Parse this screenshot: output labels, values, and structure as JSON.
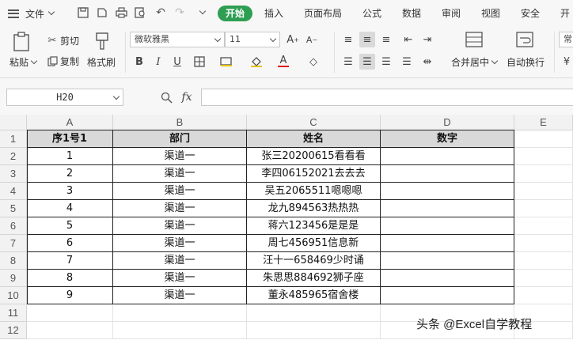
{
  "menubar": {
    "file_label": "文件",
    "tabs": [
      "开始",
      "插入",
      "页面布局",
      "公式",
      "数据",
      "审阅",
      "视图",
      "安全",
      "开"
    ]
  },
  "ribbon": {
    "paste_label": "粘贴",
    "cut_label": "剪切",
    "copy_label": "复制",
    "format_painter_label": "格式刷",
    "font_name": "微软雅黑",
    "font_size": "11",
    "merge_center_label": "合并居中",
    "wrap_text_label": "自动换行",
    "number_format_label": "常"
  },
  "formula_bar": {
    "name_box": "H20",
    "fx_label": "fx",
    "formula_value": ""
  },
  "sheet": {
    "columns": [
      "A",
      "B",
      "C",
      "D",
      "E"
    ],
    "row_numbers": [
      "1",
      "2",
      "3",
      "4",
      "5",
      "6",
      "7",
      "8",
      "9",
      "10",
      "11",
      "12"
    ],
    "header": [
      "序1号1",
      "部门",
      "姓名",
      "数字"
    ],
    "rows": [
      [
        "1",
        "渠道一",
        "张三20200615看看看",
        ""
      ],
      [
        "2",
        "渠道一",
        "李四06152021去去去",
        ""
      ],
      [
        "3",
        "渠道一",
        "吴五2065511嗯嗯嗯",
        ""
      ],
      [
        "4",
        "渠道一",
        "龙九894563热热热",
        ""
      ],
      [
        "5",
        "渠道一",
        "蒋六123456是是是",
        ""
      ],
      [
        "6",
        "渠道一",
        "周七456951信息新",
        ""
      ],
      [
        "7",
        "渠道一",
        "汪十一658469少时诵",
        ""
      ],
      [
        "8",
        "渠道一",
        "朱思思884692狮子座",
        ""
      ],
      [
        "9",
        "渠道一",
        "董永485965宿舍楼",
        ""
      ]
    ]
  },
  "watermark": "头条 @Excel自学教程",
  "colors": {
    "accent": "#2e9e53",
    "header_fill": "#d9d9d9"
  }
}
